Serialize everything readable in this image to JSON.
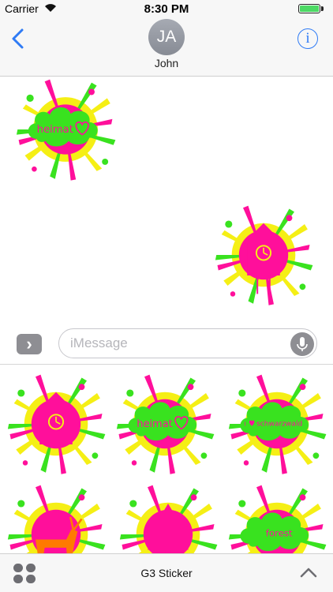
{
  "status_bar": {
    "carrier": "Carrier",
    "time": "8:30 PM"
  },
  "nav": {
    "avatar_initials": "JA",
    "contact_name": "John",
    "info_label": "i"
  },
  "input_bar": {
    "apps_label": "›",
    "placeholder": "iMessage"
  },
  "drawer": {
    "labels": {
      "heimat": "heimat",
      "schwarzwald": "schwarzwald",
      "forest": "forest"
    }
  },
  "bottom_bar": {
    "app_name": "G3 Sticker"
  },
  "colors": {
    "green": "#39e21f",
    "magenta": "#ff0f9b",
    "yellow": "#f5ef15",
    "orange": "#ff7a00",
    "accent": "#2f7bf5"
  }
}
